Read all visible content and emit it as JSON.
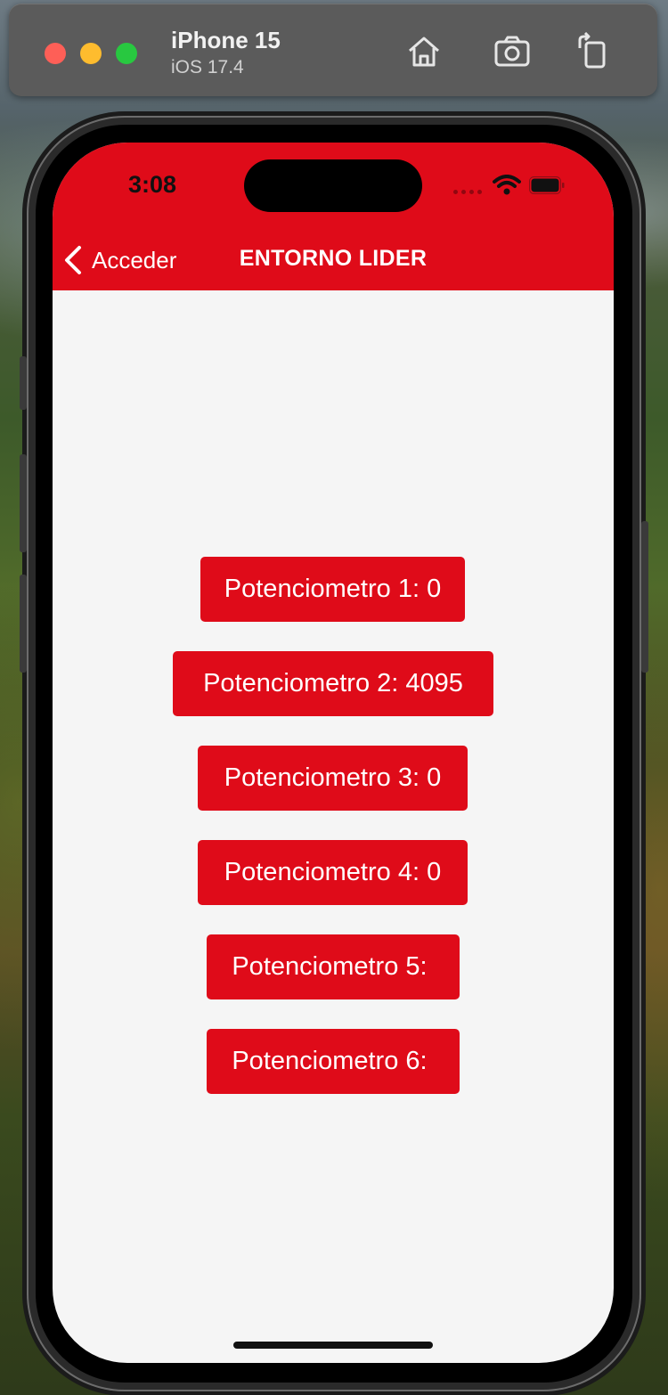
{
  "simulator": {
    "device_name": "iPhone 15",
    "os_version": "iOS 17.4",
    "icons": [
      "home-icon",
      "screenshot-icon",
      "rotate-icon"
    ]
  },
  "status_bar": {
    "time": "3:08"
  },
  "nav": {
    "back_label": "Acceder",
    "title": "ENTORNO LIDER"
  },
  "buttons": [
    {
      "label": "Potenciometro 1: 0"
    },
    {
      "label": "Potenciometro 2: 4095"
    },
    {
      "label": "Potenciometro 3: 0"
    },
    {
      "label": "Potenciometro 4: 0"
    },
    {
      "label": "Potenciometro 5: "
    },
    {
      "label": "Potenciometro 6: "
    }
  ],
  "colors": {
    "accent": "#df0b19",
    "screen_background": "#f5f5f5"
  }
}
